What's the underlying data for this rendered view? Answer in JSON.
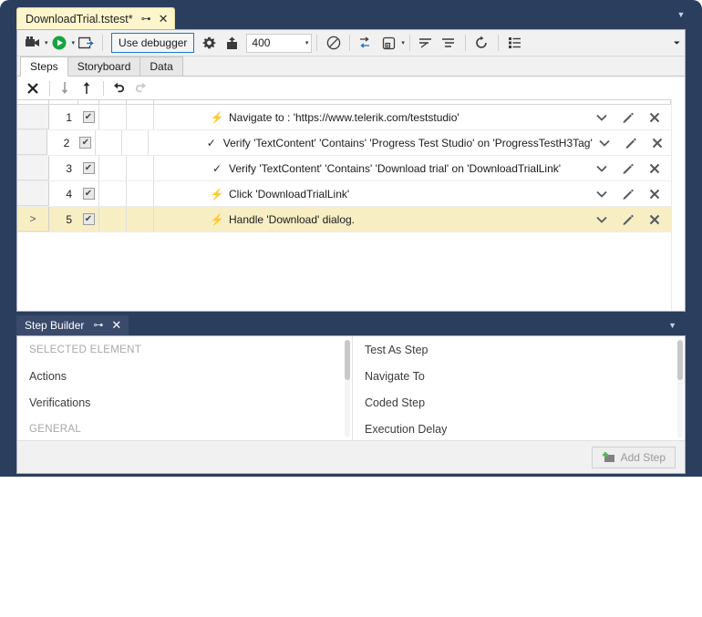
{
  "window": {
    "document_tab": {
      "title": "DownloadTrial.tstest*",
      "pin_icon": "pin-icon",
      "close_icon": "close-icon"
    },
    "collapse_icon": "chevron-down-icon"
  },
  "toolbar": {
    "record_label": "record-icon",
    "record_caret": "▾",
    "run_label": "run-icon",
    "run_caret": "▾",
    "step_into_label": "step-into-icon",
    "use_debugger_label": "Use debugger",
    "settings_label": "gear-icon",
    "export_label": "export-icon",
    "speed_value": "400",
    "speed_caret": "▾",
    "annotate_label": "annotation-icon",
    "data_label": "database-icon",
    "data_caret": "▾",
    "indent_label": "indent-icon",
    "outdent_label": "outdent-icon",
    "reload_label": "refresh-icon",
    "list_label": "list-icon",
    "overflow_label": "⏷"
  },
  "view_tabs": [
    {
      "label": "Steps",
      "active": true
    },
    {
      "label": "Storyboard",
      "active": false
    },
    {
      "label": "Data",
      "active": false
    }
  ],
  "steps_toolbar": {
    "delete_label": "✕",
    "move_down_label": "↓",
    "move_up_label": "↑",
    "undo_label": "↺",
    "redo_label": "↻"
  },
  "steps": {
    "rows": [
      {
        "indicator": "",
        "number": "1",
        "checked": "✔",
        "icon_glyph": "⚡",
        "icon_name": "action-bolt-icon",
        "description": "Navigate to : 'https://www.telerik.com/teststudio'",
        "selected": false
      },
      {
        "indicator": "",
        "number": "2",
        "checked": "✔",
        "icon_glyph": "✓",
        "icon_name": "verification-check-icon",
        "description": "Verify 'TextContent' 'Contains' 'Progress Test Studio' on 'ProgressTestH3Tag'",
        "selected": false
      },
      {
        "indicator": "",
        "number": "3",
        "checked": "✔",
        "icon_glyph": "✓",
        "icon_name": "verification-check-icon",
        "description": "Verify 'TextContent' 'Contains' 'Download trial' on 'DownloadTrialLink'",
        "selected": false
      },
      {
        "indicator": "",
        "number": "4",
        "checked": "✔",
        "icon_glyph": "⚡",
        "icon_name": "action-bolt-icon",
        "description": "Click 'DownloadTrialLink'",
        "selected": false
      },
      {
        "indicator": ">",
        "number": "5",
        "checked": "✔",
        "icon_glyph": "⚡",
        "icon_name": "action-bolt-icon",
        "description": "Handle 'Download' dialog.",
        "selected": true
      }
    ],
    "row_actions": {
      "expand_label": "⌄",
      "edit_label": "edit-pencil-icon",
      "remove_label": "✕"
    }
  },
  "step_builder": {
    "tab_title": "Step Builder",
    "pin_icon": "pin-icon",
    "close_icon": "close-icon",
    "collapse_icon": "chevron-down-icon",
    "left_items": [
      {
        "label": "SELECTED ELEMENT",
        "group": true
      },
      {
        "label": "Actions",
        "group": false
      },
      {
        "label": "Verifications",
        "group": false
      },
      {
        "label": "GENERAL",
        "group": true
      }
    ],
    "right_items": [
      {
        "label": "Test As Step",
        "group": false
      },
      {
        "label": "Navigate To",
        "group": false
      },
      {
        "label": "Coded Step",
        "group": false
      },
      {
        "label": "Execution Delay",
        "group": false
      }
    ],
    "add_step_label": "Add Step",
    "add_step_icon": "add-step-icon"
  },
  "colors": {
    "window_chrome": "#2c3e5d",
    "doc_tab": "#fdf6cd",
    "selected_row": "#f7eec4",
    "accent_border": "#1a7ac4",
    "panel_header": "#3a4a6b"
  }
}
